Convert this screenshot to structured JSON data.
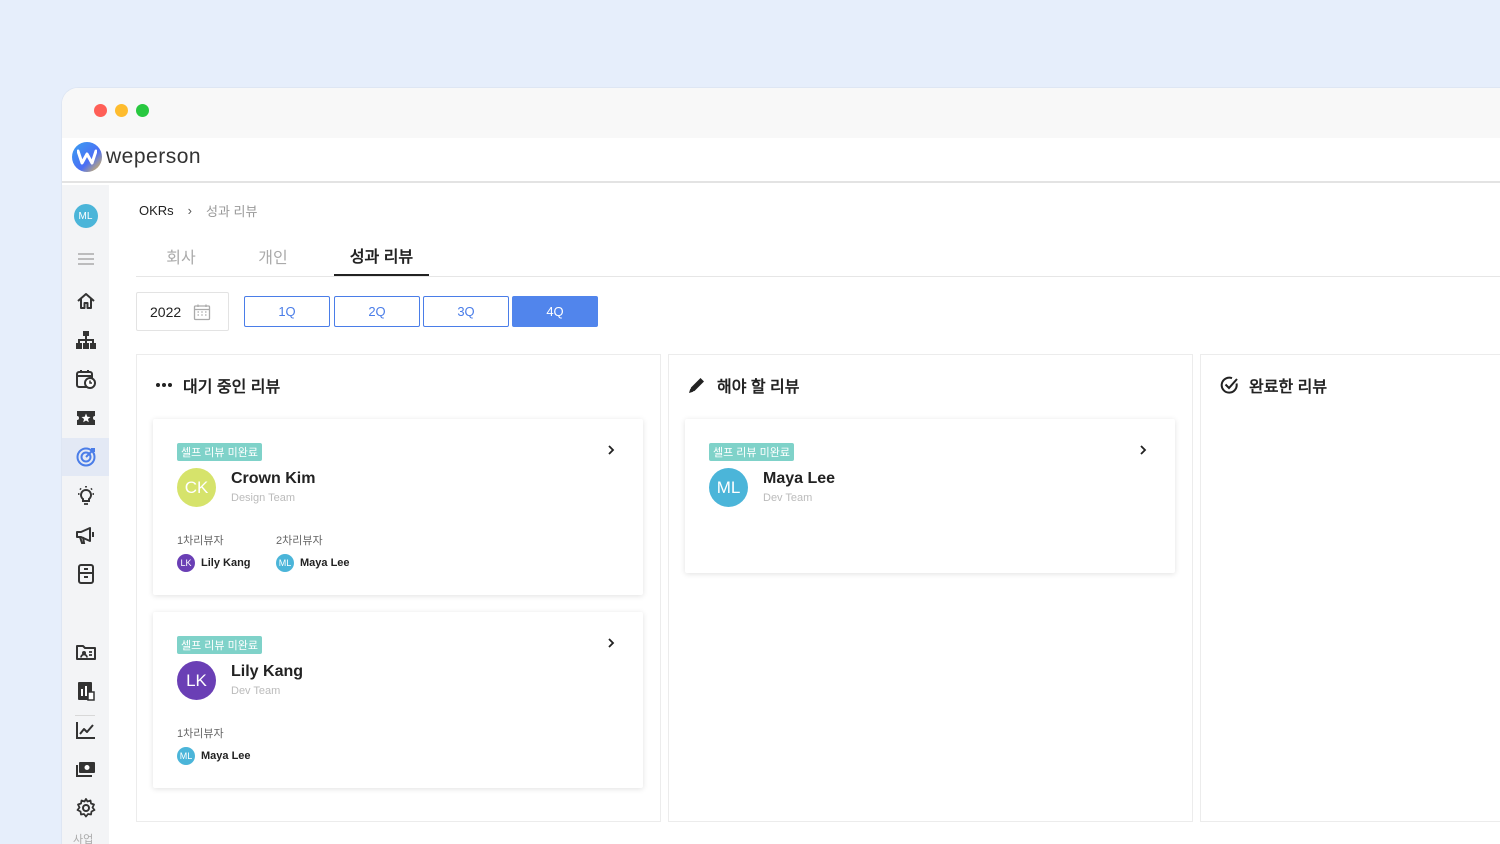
{
  "app": {
    "logo_text": "weperson"
  },
  "sidebar": {
    "avatar": "ML",
    "bottom_text": "사업",
    "icons": [
      "menu-icon",
      "home-icon",
      "org-chart-icon",
      "calendar-clock-icon",
      "star-ticket-icon",
      "target-icon",
      "lightbulb-icon",
      "megaphone-icon",
      "document-icon",
      "id-card-icon",
      "report-icon",
      "line-chart-icon",
      "money-icon",
      "settings-icon"
    ]
  },
  "breadcrumb": {
    "root": "OKRs",
    "separator": "›",
    "current": "성과 리뷰"
  },
  "tabs": {
    "company": "회사",
    "personal": "개인",
    "review": "성과 리뷰"
  },
  "filter": {
    "year": "2022",
    "quarters": [
      "1Q",
      "2Q",
      "3Q",
      "4Q"
    ],
    "selected_quarter": "4Q"
  },
  "columns": {
    "pending": {
      "title": "대기 중인 리뷰",
      "cards": [
        {
          "badge": "셀프 리뷰 미완료",
          "initials": "CK",
          "name": "Crown Kim",
          "team": "Design Team",
          "reviewer1_label": "1차리뷰자",
          "reviewer1_initials": "LK",
          "reviewer1_name": "Lily Kang",
          "reviewer2_label": "2차리뷰자",
          "reviewer2_initials": "ML",
          "reviewer2_name": "Maya Lee"
        },
        {
          "badge": "셀프 리뷰 미완료",
          "initials": "LK",
          "name": "Lily Kang",
          "team": "Dev Team",
          "reviewer1_label": "1차리뷰자",
          "reviewer1_initials": "ML",
          "reviewer1_name": "Maya Lee"
        }
      ]
    },
    "todo": {
      "title": "해야 할 리뷰",
      "cards": [
        {
          "badge": "셀프 리뷰 미완료",
          "initials": "ML",
          "name": "Maya Lee",
          "team": "Dev Team"
        }
      ]
    },
    "done": {
      "title": "완료한 리뷰"
    }
  },
  "colors": {
    "accent": "#5185ec",
    "badge": "#7fd2c9",
    "avatar_ck": "#d6e36b",
    "avatar_lk": "#6a3fb5",
    "avatar_ml": "#4bb5d9"
  }
}
